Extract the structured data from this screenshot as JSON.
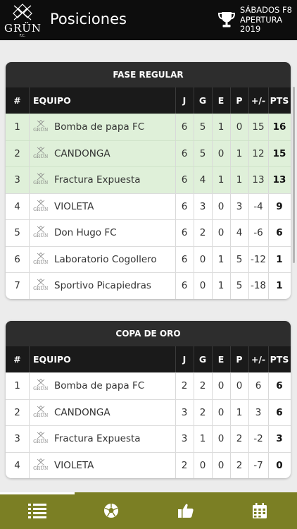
{
  "header": {
    "logo_text": "GRÜN",
    "logo_sub": "F.C.",
    "title": "Posiciones",
    "tournament_line1": "SÁBADOS F8",
    "tournament_line2": "APERTURA",
    "tournament_line3": "2019"
  },
  "columns": {
    "pos": "#",
    "team": "EQUIPO",
    "j": "J",
    "g": "G",
    "e": "E",
    "p": "P",
    "dif": "+/-",
    "pts": "PTS"
  },
  "team_logo_text": "GRÜN",
  "tables": [
    {
      "title": "FASE REGULAR",
      "rows": [
        {
          "pos": "1",
          "team": "Bomba de papa FC",
          "j": "6",
          "g": "5",
          "e": "1",
          "p": "0",
          "dif": "15",
          "pts": "16",
          "highlight": true
        },
        {
          "pos": "2",
          "team": "CANDONGA",
          "j": "6",
          "g": "5",
          "e": "0",
          "p": "1",
          "dif": "12",
          "pts": "15",
          "highlight": true
        },
        {
          "pos": "3",
          "team": "Fractura Expuesta",
          "j": "6",
          "g": "4",
          "e": "1",
          "p": "1",
          "dif": "13",
          "pts": "13",
          "highlight": true
        },
        {
          "pos": "4",
          "team": "VIOLETA",
          "j": "6",
          "g": "3",
          "e": "0",
          "p": "3",
          "dif": "-4",
          "pts": "9",
          "highlight": false
        },
        {
          "pos": "5",
          "team": "Don Hugo FC",
          "j": "6",
          "g": "2",
          "e": "0",
          "p": "4",
          "dif": "-6",
          "pts": "6",
          "highlight": false
        },
        {
          "pos": "6",
          "team": "Laboratorio Cogollero",
          "j": "6",
          "g": "0",
          "e": "1",
          "p": "5",
          "dif": "-12",
          "pts": "1",
          "highlight": false
        },
        {
          "pos": "7",
          "team": "Sportivo Picapiedras",
          "j": "6",
          "g": "0",
          "e": "1",
          "p": "5",
          "dif": "-18",
          "pts": "1",
          "highlight": false
        }
      ]
    },
    {
      "title": "COPA DE ORO",
      "rows": [
        {
          "pos": "1",
          "team": "Bomba de papa FC",
          "j": "2",
          "g": "2",
          "e": "0",
          "p": "0",
          "dif": "6",
          "pts": "6",
          "highlight": false
        },
        {
          "pos": "2",
          "team": "CANDONGA",
          "j": "3",
          "g": "2",
          "e": "0",
          "p": "1",
          "dif": "3",
          "pts": "6",
          "highlight": false
        },
        {
          "pos": "3",
          "team": "Fractura Expuesta",
          "j": "3",
          "g": "1",
          "e": "0",
          "p": "2",
          "dif": "-2",
          "pts": "3",
          "highlight": false
        },
        {
          "pos": "4",
          "team": "VIOLETA",
          "j": "2",
          "g": "0",
          "e": "0",
          "p": "2",
          "dif": "-7",
          "pts": "0",
          "highlight": false
        }
      ]
    }
  ],
  "nav": [
    {
      "icon": "list-icon",
      "active": true
    },
    {
      "icon": "soccer-ball-icon",
      "active": false
    },
    {
      "icon": "thumbs-up-icon",
      "active": false
    },
    {
      "icon": "calendar-icon",
      "active": false
    }
  ],
  "colors": {
    "header_bg": "#0d0d0d",
    "nav_bg": "#7b7f24",
    "promo_row": "#dff0d9"
  }
}
